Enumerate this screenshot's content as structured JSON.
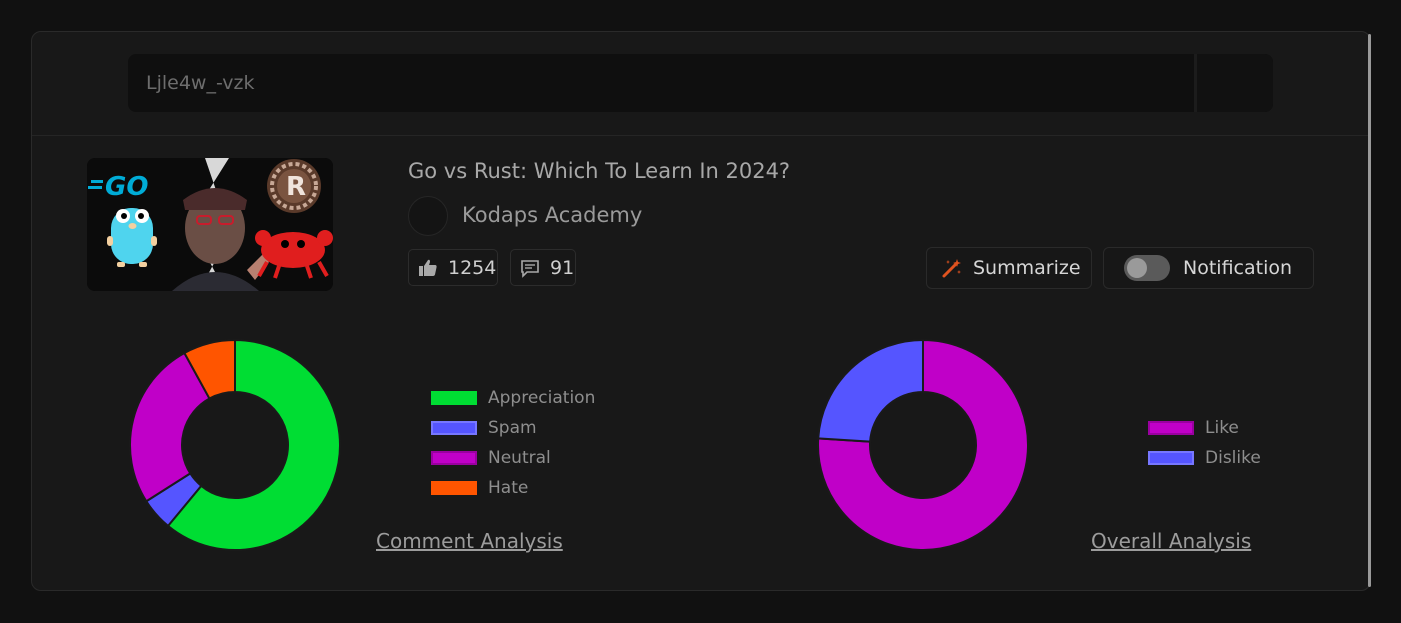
{
  "search": {
    "value": "Ljle4w_-vzk",
    "placeholder": ""
  },
  "video": {
    "title": "Go vs Rust: Which To Learn In 2024?",
    "channel": "Kodaps Academy",
    "thumbnail_text": {
      "go_logo": "GO",
      "rust_logo": "R"
    },
    "likes": "1254",
    "comments": "91"
  },
  "actions": {
    "summarize_label": "Summarize",
    "notification_label": "Notification",
    "notification_on": false
  },
  "charts": {
    "comment_analysis_link": "Comment Analysis",
    "overall_analysis_link": "Overall Analysis"
  },
  "chart_data": [
    {
      "type": "pie",
      "title": "Comment Analysis",
      "categories": [
        "Appreciation",
        "Spam",
        "Neutral",
        "Hate"
      ],
      "values": [
        61,
        5,
        26,
        8
      ],
      "colors": [
        "#00dd33",
        "#5555ff",
        "#c000c8",
        "#ff5500"
      ],
      "legend": "right"
    },
    {
      "type": "pie",
      "title": "Overall Analysis",
      "categories": [
        "Like",
        "Dislike"
      ],
      "values": [
        76,
        24
      ],
      "colors": [
        "#c000c8",
        "#5555ff"
      ],
      "legend": "right"
    }
  ],
  "colors": {
    "background": "#111111",
    "panel": "#181818",
    "accent_icon": "#e0531f"
  },
  "icons": [
    "thumbs-up-icon",
    "comment-icon",
    "magic-wand-icon"
  ]
}
